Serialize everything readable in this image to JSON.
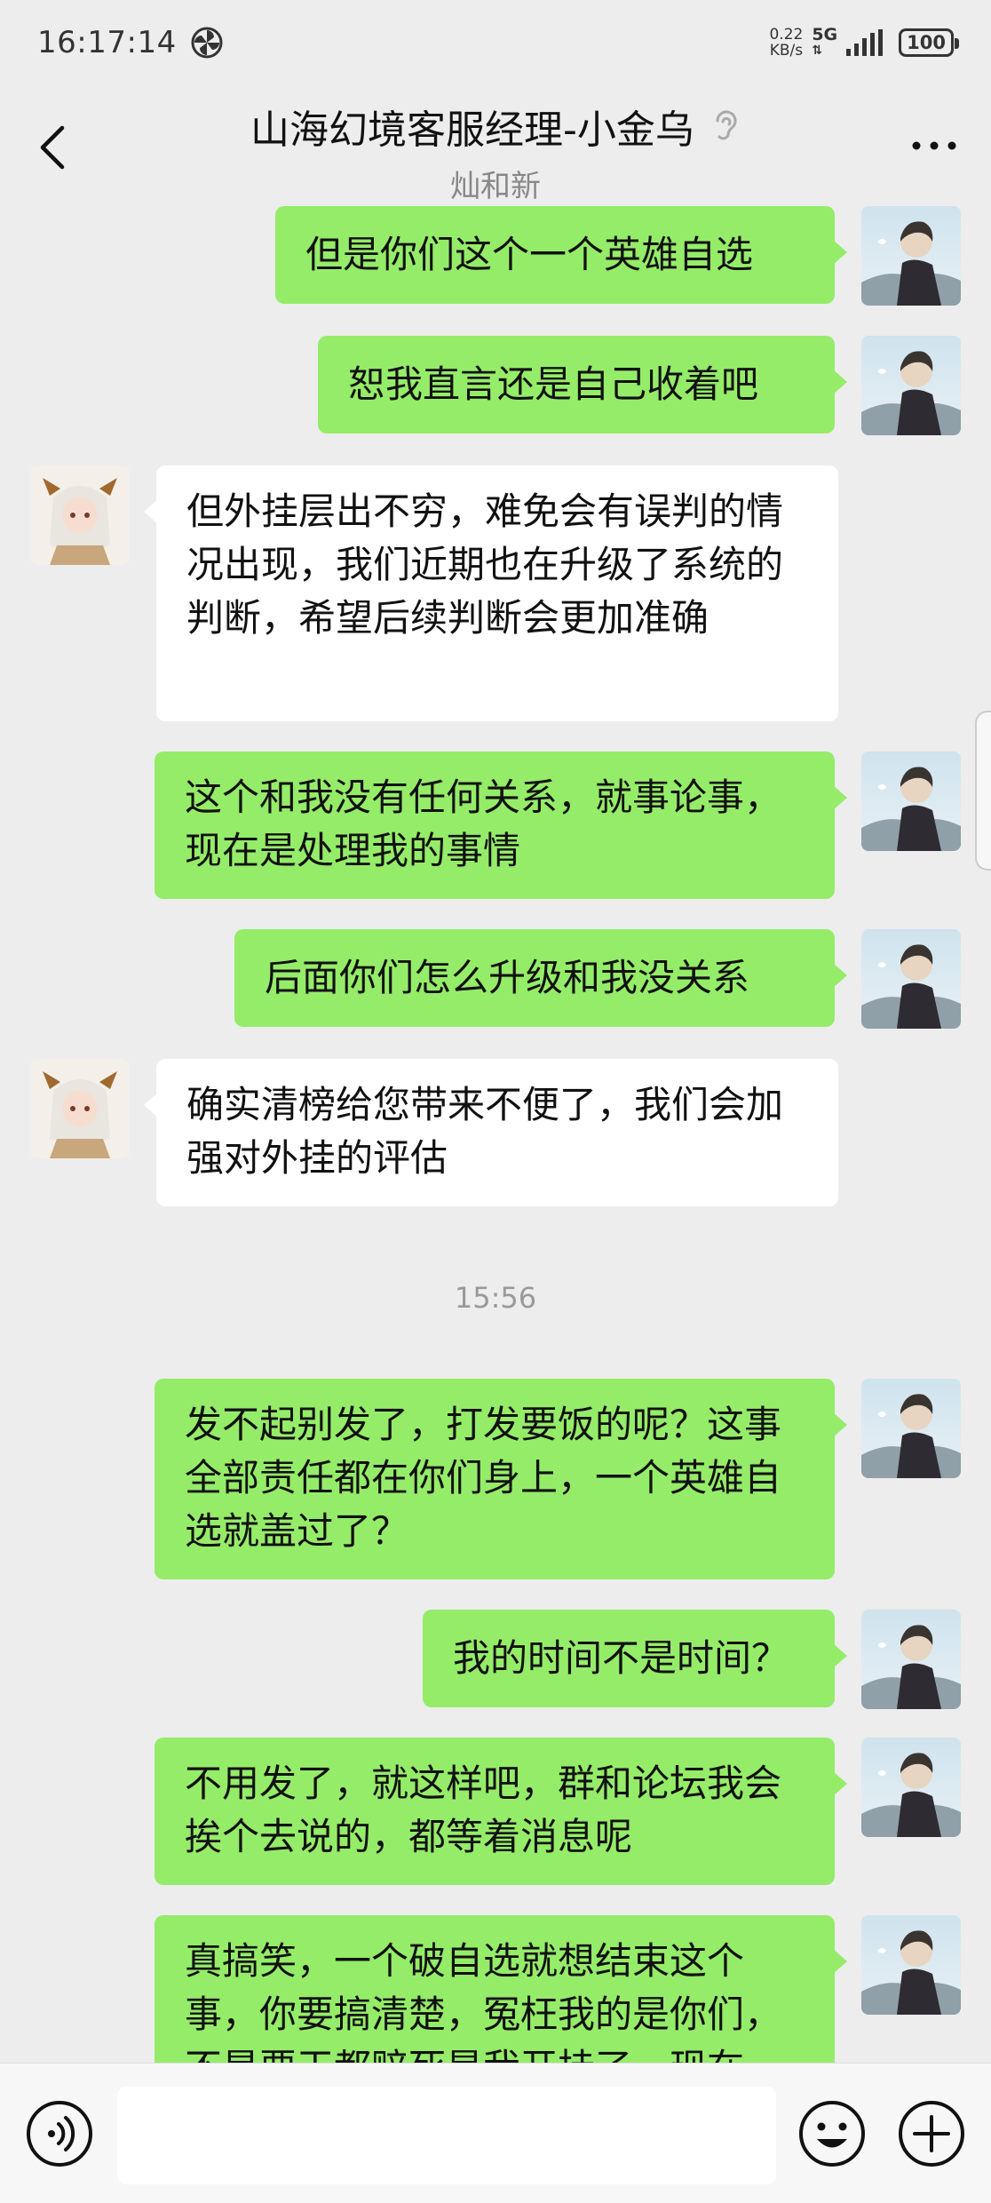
{
  "status_bar": {
    "time": "16:17:14",
    "net_speed": "0.22",
    "net_speed_unit": "KB/s",
    "network": "5G",
    "battery": "100"
  },
  "header": {
    "title": "山海幻境客服经理-小金乌",
    "subtitle": "灿和新"
  },
  "messages": [
    {
      "side": "me",
      "text": "但是你们这个一个英雄自选"
    },
    {
      "side": "me",
      "text": "恕我直言还是自己收着吧"
    },
    {
      "side": "them",
      "text": "但外挂层出不穷，难免会有误判的情况出现，我们近期也在升级了系统的判断，希望后续判断会更加准确"
    },
    {
      "side": "me",
      "text": "这个和我没有任何关系，就事论事，现在是处理我的事情"
    },
    {
      "side": "me",
      "text": "后面你们怎么升级和我没关系"
    },
    {
      "side": "them",
      "text": "确实清榜给您带来不便了，我们会加强对外挂的评估"
    },
    {
      "side": "me",
      "text": "发不起别发了，打发要饭的呢？这事全部责任都在你们身上，一个英雄自选就盖过了？"
    },
    {
      "side": "me",
      "text": "我的时间不是时间？"
    },
    {
      "side": "me",
      "text": "不用发了，就这样吧，群和论坛我会挨个去说的，都等着消息呢"
    },
    {
      "side": "me",
      "text": "真搞笑，一个破自选就想结束这个事，你要搞清楚，冤枉我的是你们，不是要干都赔死是我开挂了，现在"
    }
  ],
  "timestamp": "15:56",
  "colors": {
    "background": "#ededed",
    "my_bubble": "#95ec69",
    "their_bubble": "#ffffff"
  }
}
